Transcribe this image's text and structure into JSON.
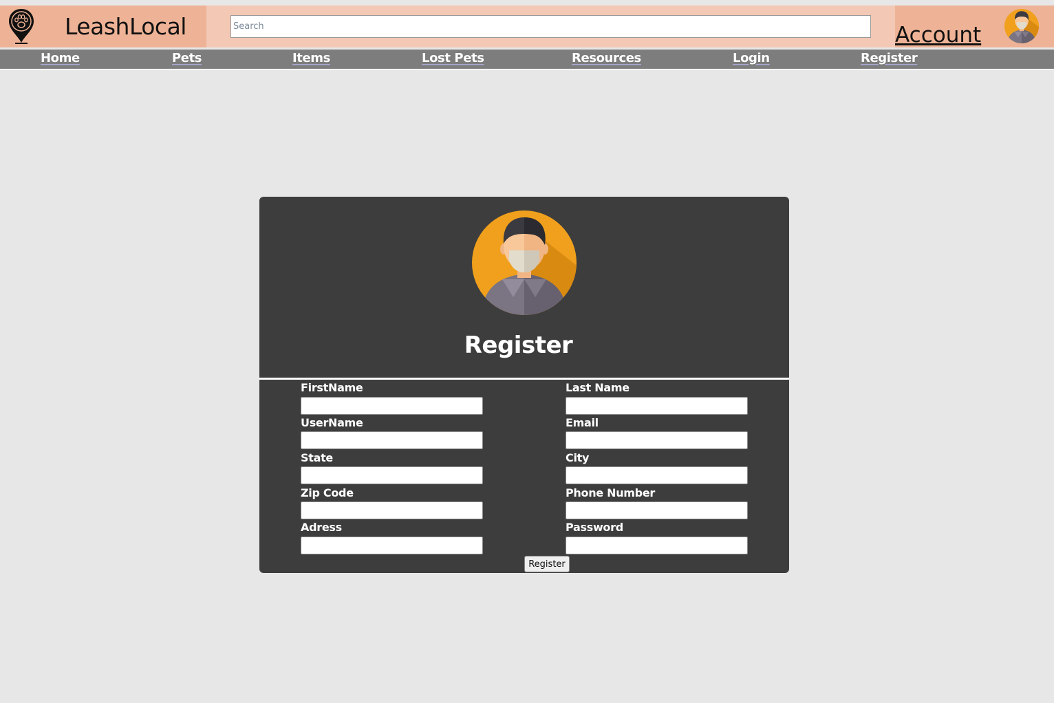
{
  "header": {
    "brand_name": "LeashLocal",
    "search_placeholder": "Search",
    "account_label": "Account"
  },
  "nav": {
    "items": [
      {
        "label": "Home"
      },
      {
        "label": "Pets"
      },
      {
        "label": "Items"
      },
      {
        "label": "Lost Pets"
      },
      {
        "label": "Resources"
      },
      {
        "label": "Login"
      },
      {
        "label": "Register"
      }
    ]
  },
  "form": {
    "title": "Register",
    "fields": [
      {
        "label": "FirstName"
      },
      {
        "label": "Last Name"
      },
      {
        "label": "UserName"
      },
      {
        "label": "Email"
      },
      {
        "label": "State"
      },
      {
        "label": "City"
      },
      {
        "label": "Zip Code"
      },
      {
        "label": "Phone Number"
      },
      {
        "label": "Adress"
      },
      {
        "label": "Password"
      }
    ],
    "submit_label": "Register"
  },
  "colors": {
    "header_bg": "#f3c8b4",
    "brand_bg": "#eeb396",
    "nav_bg": "#7d7d7d",
    "page_bg": "#e7e7e7",
    "card_bg": "#3d3d3d",
    "avatar_orange": "#f0a01c"
  },
  "icons": {
    "logo": "paw-location-pin-icon",
    "avatar": "masked-person-avatar-icon"
  }
}
